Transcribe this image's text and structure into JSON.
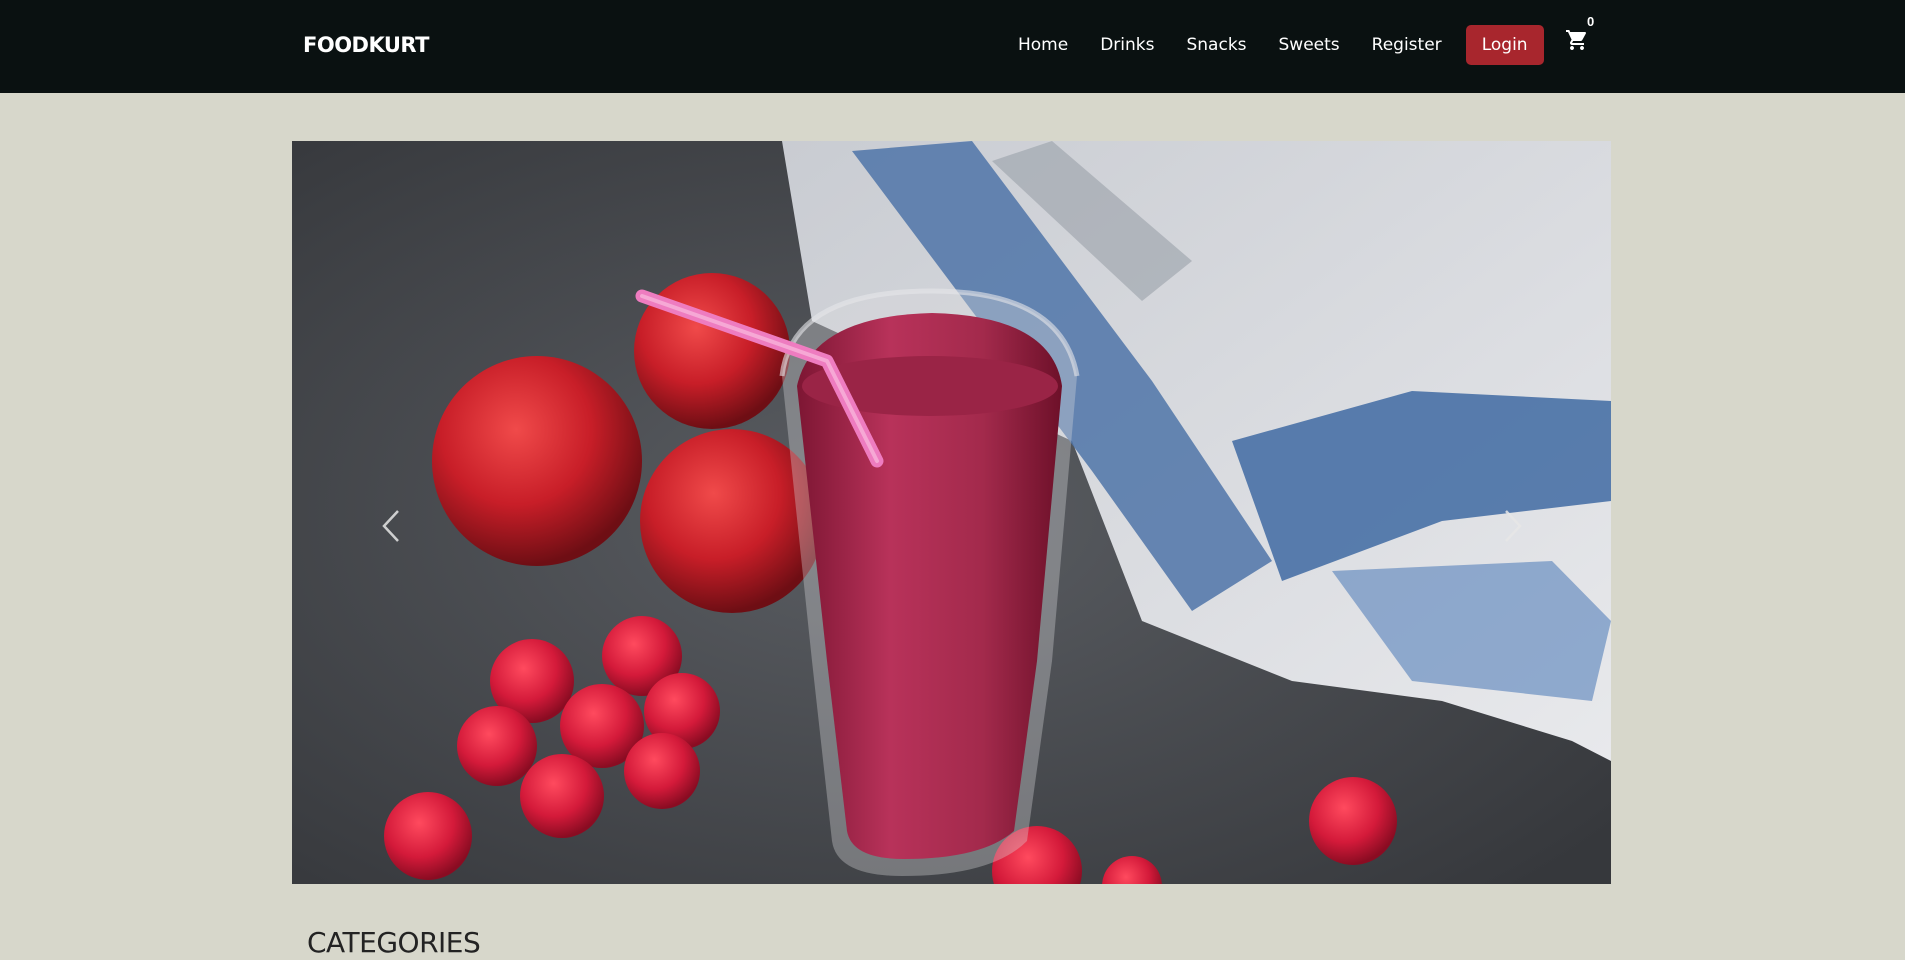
{
  "brand": "FOODKURT",
  "nav": {
    "links": [
      "Home",
      "Drinks",
      "Snacks",
      "Sweets",
      "Register"
    ],
    "login_label": "Login",
    "cart_count": "0"
  },
  "carousel": {
    "slide_image": "berry-smoothie-with-apples-and-raspberries",
    "prev_icon": "chevron-left-icon",
    "next_icon": "chevron-right-icon"
  },
  "sections": {
    "categories_title": "CATEGORIES"
  },
  "colors": {
    "navbar_bg": "#0a1111",
    "page_bg": "#d7d7cb",
    "login_bg": "#a8262d"
  }
}
